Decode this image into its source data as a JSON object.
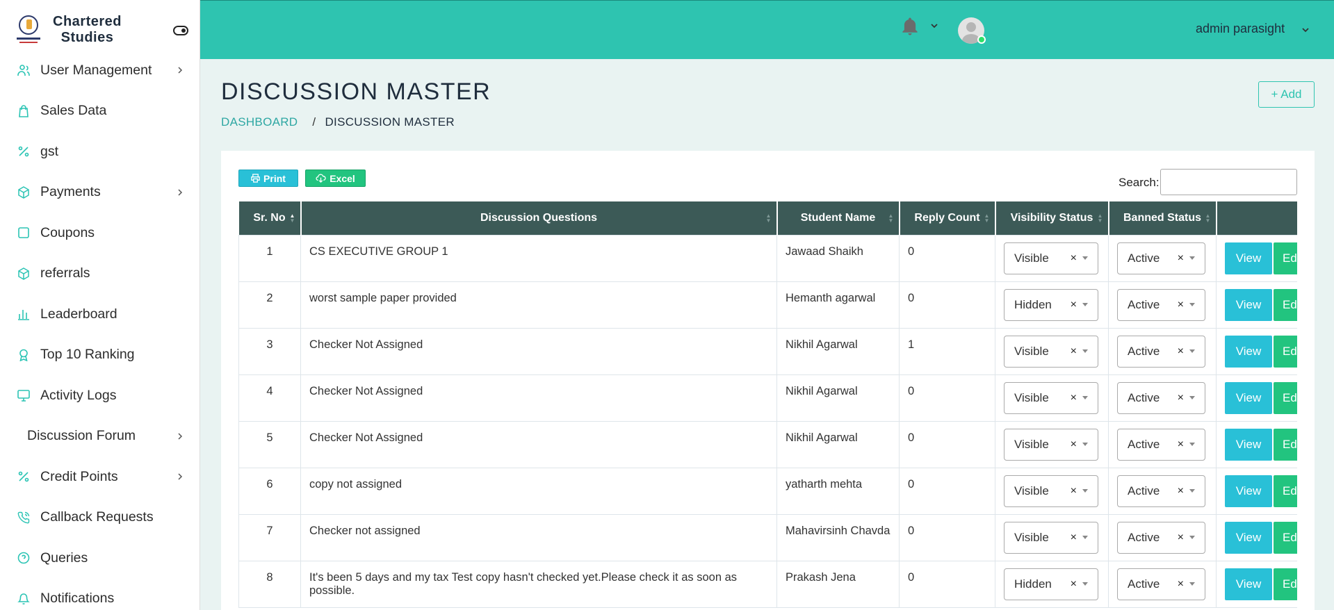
{
  "brand": {
    "line1": "Chartered",
    "line2": "Studies",
    "logo_text": "Chartered Studies"
  },
  "sidebar": {
    "items": [
      {
        "label": "User Management",
        "icon": "users-icon",
        "has_chevron": true
      },
      {
        "label": "Sales Data",
        "icon": "shopping-bag-icon",
        "has_chevron": false
      },
      {
        "label": "gst",
        "icon": "percent-icon",
        "has_chevron": false
      },
      {
        "label": "Payments",
        "icon": "box-icon",
        "has_chevron": true
      },
      {
        "label": "Coupons",
        "icon": "square-icon",
        "has_chevron": false
      },
      {
        "label": "referrals",
        "icon": "box-icon",
        "has_chevron": false
      },
      {
        "label": "Leaderboard",
        "icon": "bar-chart-icon",
        "has_chevron": false
      },
      {
        "label": "Top 10 Ranking",
        "icon": "award-icon",
        "has_chevron": false
      },
      {
        "label": "Activity Logs",
        "icon": "monitor-icon",
        "has_chevron": false
      },
      {
        "label": "Discussion Forum",
        "icon": "",
        "has_chevron": true
      },
      {
        "label": "Credit Points",
        "icon": "percent-icon",
        "has_chevron": true
      },
      {
        "label": "Callback Requests",
        "icon": "phone-icon",
        "has_chevron": false
      },
      {
        "label": "Queries",
        "icon": "help-circle-icon",
        "has_chevron": false
      },
      {
        "label": "Notifications",
        "icon": "bell-icon",
        "has_chevron": false
      }
    ]
  },
  "header": {
    "user_name": "admin parasight"
  },
  "page": {
    "title": "DISCUSSION MASTER",
    "breadcrumb_home": "DASHBOARD",
    "breadcrumb_sep": "/",
    "breadcrumb_current": "DISCUSSION MASTER",
    "add_label": "+ Add"
  },
  "toolbar": {
    "print_label": "Print",
    "excel_label": "Excel",
    "search_label": "Search:",
    "search_value": ""
  },
  "table": {
    "columns": [
      "Sr. No",
      "Discussion Questions",
      "Student Name",
      "Reply Count",
      "Visibility Status",
      "Banned Status",
      ""
    ],
    "view_label": "View",
    "edit_label": "Edit",
    "clear_symbol": "×",
    "rows": [
      {
        "sr": "1",
        "question": "CS EXECUTIVE GROUP 1",
        "student": "Jawaad Shaikh",
        "replies": "0",
        "visibility": "Visible",
        "banned": "Active"
      },
      {
        "sr": "2",
        "question": "worst sample paper provided",
        "student": "Hemanth agarwal",
        "replies": "0",
        "visibility": "Hidden",
        "banned": "Active"
      },
      {
        "sr": "3",
        "question": "Checker Not Assigned",
        "student": "Nikhil Agarwal",
        "replies": "1",
        "visibility": "Visible",
        "banned": "Active"
      },
      {
        "sr": "4",
        "question": "Checker Not Assigned",
        "student": "Nikhil Agarwal",
        "replies": "0",
        "visibility": "Visible",
        "banned": "Active"
      },
      {
        "sr": "5",
        "question": "Checker Not Assigned",
        "student": "Nikhil Agarwal",
        "replies": "0",
        "visibility": "Visible",
        "banned": "Active"
      },
      {
        "sr": "6",
        "question": "copy not assigned",
        "student": "yatharth mehta",
        "replies": "0",
        "visibility": "Visible",
        "banned": "Active"
      },
      {
        "sr": "7",
        "question": "Checker not assigned",
        "student": "Mahavirsinh Chavda",
        "replies": "0",
        "visibility": "Visible",
        "banned": "Active"
      },
      {
        "sr": "8",
        "question": "It's been 5 days and my tax Test copy hasn't checked yet.Please check it as soon as possible.",
        "student": "Prakash Jena",
        "replies": "0",
        "visibility": "Hidden",
        "banned": "Active"
      }
    ]
  },
  "colors": {
    "primary": "#2ec4b0",
    "header_bg": "#3c5a57",
    "view": "#29c0d7",
    "excel": "#22c47f",
    "bg": "#e9f3f2"
  }
}
